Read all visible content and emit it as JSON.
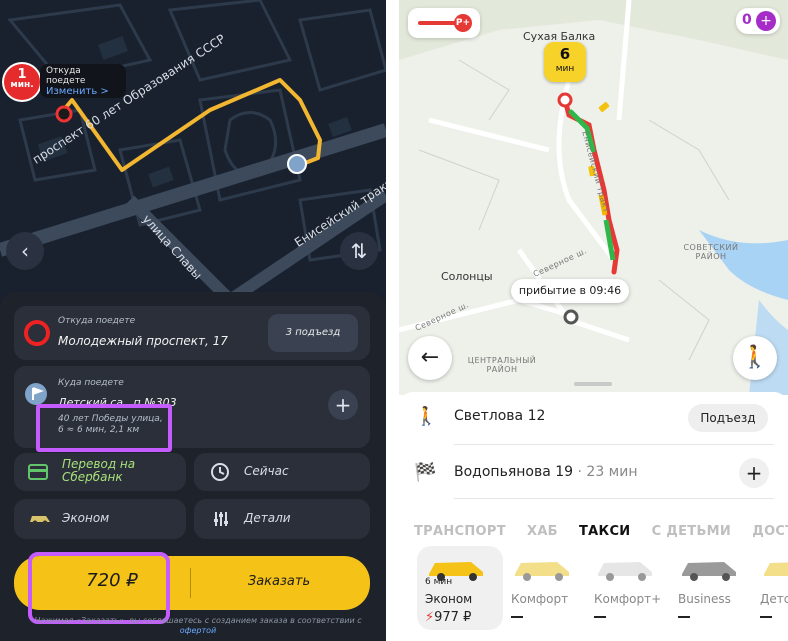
{
  "left": {
    "map": {
      "eta_badge": "1",
      "eta_badge_unit": "мин.",
      "from_tip_label": "Откуда поедете",
      "from_tip_action": "Изменить >",
      "streets": [
        "проспект 60 лет Образования СССР",
        "улица Славы",
        "Енисейский тракт"
      ]
    },
    "from": {
      "label": "Откуда поедете",
      "address": "Молодежный проспект, 17",
      "entrance_button": "3 подъезд"
    },
    "to": {
      "label": "Куда поедете",
      "address": "Детский са...п №303",
      "details": "40 лет Победы улица, 6 ≈ 6 мин, 2,1 км"
    },
    "payment": "Перевод на Сбербанк",
    "time": "Сейчас",
    "tariff": "Эконом",
    "details_button": "Детали",
    "price": "720 ₽",
    "order_button": "Заказать",
    "footnote_text": "Нажимая «Заказать», вы соглашаетесь с созданием заказа в соответствии с",
    "footnote_link": "офертой"
  },
  "right": {
    "map": {
      "eta_value": "6",
      "eta_unit": "мин",
      "arrival": "прибытие в 09:46",
      "places": {
        "sukhaya_balka": "Сухая Балка",
        "solontsy": "Солонцы",
        "sovetsky_district": "СОВЕТСКИЙ РАЙОН",
        "central_district": "ЦЕНТРАЛЬНЫЙ РАЙОН",
        "severnoe_sh": "Северное ш.",
        "eniseisky_trakt": "Енисейский тракт"
      },
      "promo_count": "0"
    },
    "from_address": "Светлова 12",
    "entrance_button": "Подъезд",
    "to_address": "Водопьянова 19",
    "to_time": "· 23 мин",
    "tabs": [
      "ТРАНСПОРТ",
      "ХАБ",
      "ТАКСИ",
      "С ДЕТЬМИ",
      "ДОСТАВКА"
    ],
    "active_tab": "ТАКСИ",
    "tariffs": [
      {
        "name": "Эконом",
        "time": "6 мин",
        "price": "977 ₽",
        "selected": true
      },
      {
        "name": "Комфорт",
        "time": "",
        "price": "",
        "selected": false
      },
      {
        "name": "Комфорт+",
        "time": "",
        "price": "",
        "selected": false
      },
      {
        "name": "Business",
        "time": "",
        "price": "",
        "selected": false
      },
      {
        "name": "Детс",
        "time": "",
        "price": "",
        "selected": false
      }
    ]
  },
  "colors": {
    "accent_yellow": "#f5c218",
    "highlight_purple": "#c45cff",
    "route_yellow": "#f2b630",
    "traffic_green": "#2fb84a",
    "traffic_red": "#e53935"
  }
}
